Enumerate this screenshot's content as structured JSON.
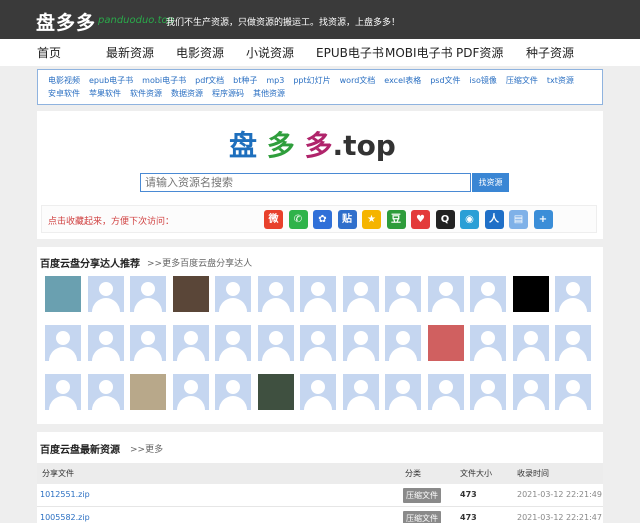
{
  "header": {
    "logo": "盘多多",
    "domain": "panduoduo.top",
    "slogan": "我们不生产资源，只做资源的搬运工。找资源，上盘多多！"
  },
  "nav": [
    "首页",
    "最新资源",
    "电影资源",
    "小说资源",
    "EPUB电子书",
    "MOBI电子书",
    "PDF资源",
    "种子资源"
  ],
  "tags": {
    "row1": [
      "电影视频",
      "epub电子书",
      "mobi电子书",
      "pdf文档",
      "bt种子",
      "mp3",
      "ppt幻灯片",
      "word文档",
      "excel表格",
      "psd文件",
      "iso镜像",
      "压缩文件",
      "txt资源"
    ],
    "row2": [
      "安卓软件",
      "苹果软件",
      "软件资源",
      "数据资源",
      "程序源码",
      "其他资源"
    ]
  },
  "search": {
    "logo_parts": [
      "盘",
      "多",
      "多",
      ".top"
    ],
    "placeholder": "请输入资源名搜索",
    "button": "找资源",
    "fav_text": "点击收藏起来，方便下次访问："
  },
  "share_icons": [
    {
      "name": "weibo-icon",
      "glyph": "微",
      "color": "#e8412c"
    },
    {
      "name": "wechat-icon",
      "glyph": "✆",
      "color": "#2fb34a"
    },
    {
      "name": "baidu-icon",
      "glyph": "✿",
      "color": "#3070d8"
    },
    {
      "name": "tieba-icon",
      "glyph": "贴",
      "color": "#2f6fcc"
    },
    {
      "name": "qzone-icon",
      "glyph": "★",
      "color": "#f5b400"
    },
    {
      "name": "douban-icon",
      "glyph": "豆",
      "color": "#2e9c3b"
    },
    {
      "name": "heart-icon",
      "glyph": "♥",
      "color": "#e33b3b"
    },
    {
      "name": "qq-icon",
      "glyph": "Q",
      "color": "#222222"
    },
    {
      "name": "video-icon",
      "glyph": "◉",
      "color": "#2b9fd6"
    },
    {
      "name": "renren-icon",
      "glyph": "人",
      "color": "#1f6fc7"
    },
    {
      "name": "copy-icon",
      "glyph": "▤",
      "color": "#7fb1e8"
    },
    {
      "name": "more-icon",
      "glyph": "+",
      "color": "#3b8ed8"
    }
  ],
  "users": {
    "title": "百度云盘分享达人推荐",
    "more": ">>更多百度云盘分享达人",
    "photo_colors": {
      "0": "#6aa0b0",
      "3": "#5a4638",
      "11": "#000000",
      "22": "#d06060",
      "28": "#b8a88a",
      "31": "#3f5040"
    }
  },
  "files": {
    "title": "百度云盘最新资源",
    "more": ">>更多",
    "columns": [
      "分享文件",
      "分类",
      "文件大小",
      "收录时间"
    ],
    "rows": [
      {
        "name": "1012551.zip",
        "category": "压缩文件",
        "size": "473",
        "time": "2021-03-12 22:21:49"
      },
      {
        "name": "1005582.zip",
        "category": "压缩文件",
        "size": "473",
        "time": "2021-03-12 22:21:47"
      }
    ]
  }
}
